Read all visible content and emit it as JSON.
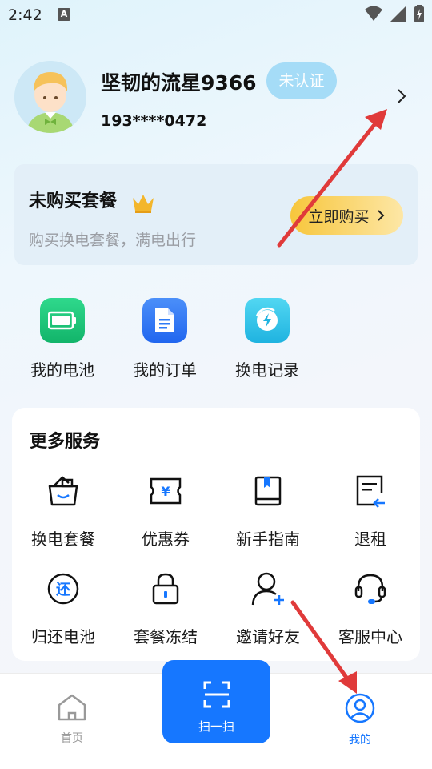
{
  "status_bar": {
    "time": "2:42",
    "notif_letter": "A"
  },
  "profile": {
    "username": "坚韧的流星9366",
    "auth_badge": "未认证",
    "phone": "193****0472"
  },
  "package_card": {
    "title": "未购买套餐",
    "subtitle": "购买换电套餐，满电出行",
    "buy_button": "立即购买"
  },
  "quick_actions": [
    {
      "label": "我的电池",
      "icon": "battery-icon",
      "color": "#18c27a"
    },
    {
      "label": "我的订单",
      "icon": "document-icon",
      "color": "#2f7bf6"
    },
    {
      "label": "换电记录",
      "icon": "swap-record-icon",
      "color": "#27c0e8"
    }
  ],
  "services": {
    "title": "更多服务",
    "items": [
      {
        "label": "换电套餐",
        "icon": "package-basket-icon"
      },
      {
        "label": "优惠券",
        "icon": "coupon-icon"
      },
      {
        "label": "新手指南",
        "icon": "guide-book-icon"
      },
      {
        "label": "退租",
        "icon": "return-rent-icon"
      },
      {
        "label": "归还电池",
        "icon": "return-battery-icon"
      },
      {
        "label": "套餐冻结",
        "icon": "lock-icon"
      },
      {
        "label": "邀请好友",
        "icon": "add-friend-icon"
      },
      {
        "label": "客服中心",
        "icon": "headset-icon"
      }
    ]
  },
  "tabbar": {
    "home": "首页",
    "scan": "扫一扫",
    "mine": "我的",
    "active_color": "#1677ff",
    "inactive_color": "#999999"
  },
  "accent": {
    "annotation_arrow": "#e03a3a",
    "brand_blue": "#1677ff",
    "badge_blue": "#a5dcf7"
  }
}
